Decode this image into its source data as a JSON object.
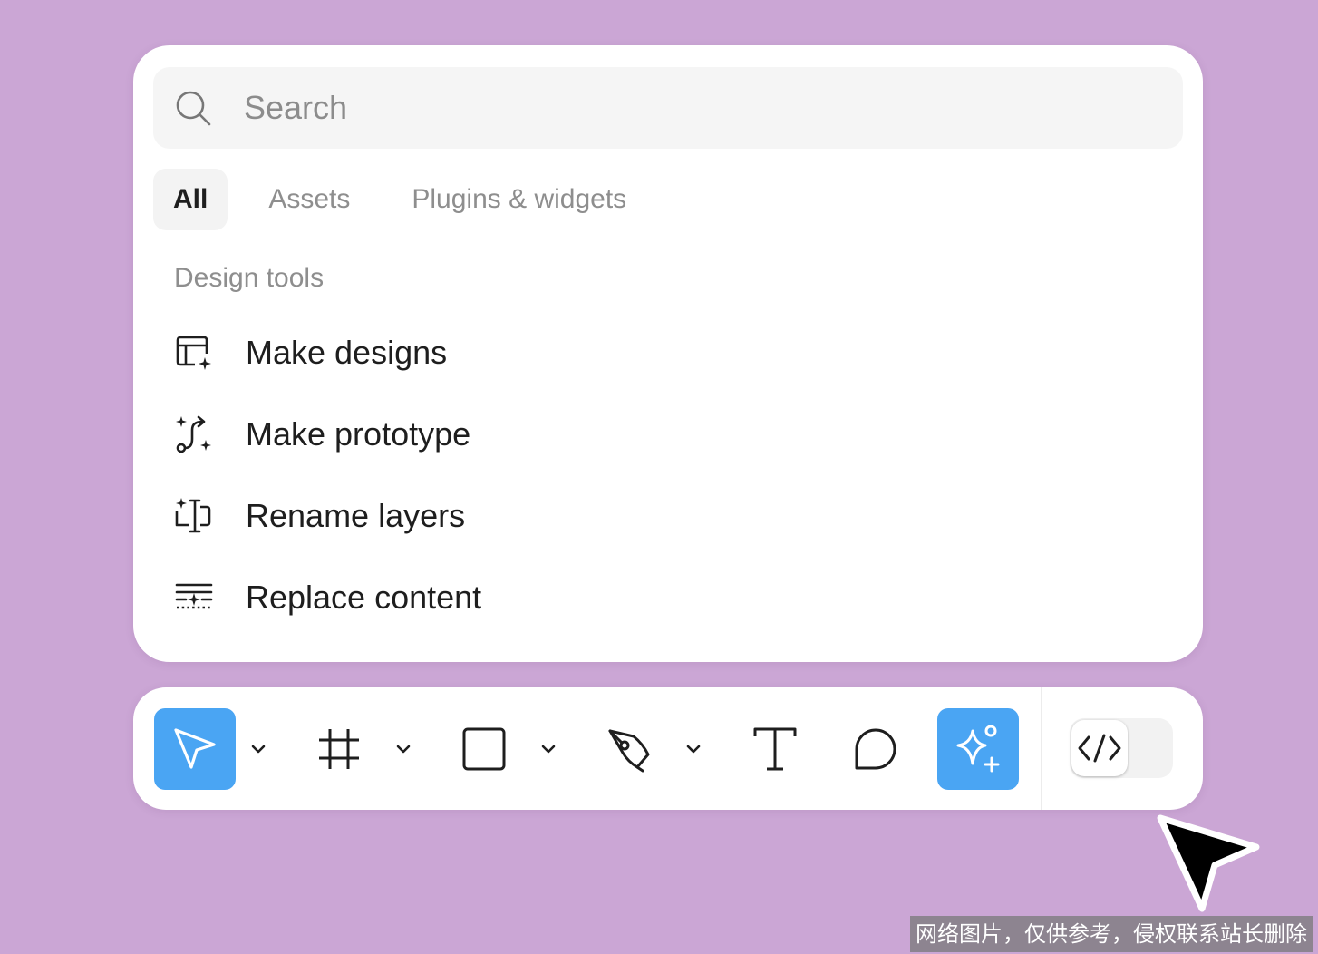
{
  "panel": {
    "search": {
      "placeholder": "Search",
      "value": "",
      "icon": "search-icon"
    },
    "tabs": [
      {
        "label": "All",
        "active": true
      },
      {
        "label": "Assets",
        "active": false
      },
      {
        "label": "Plugins & widgets",
        "active": false
      }
    ],
    "section_heading": "Design tools",
    "items": [
      {
        "label": "Make designs",
        "icon": "make-designs-icon"
      },
      {
        "label": "Make prototype",
        "icon": "make-prototype-icon"
      },
      {
        "label": "Rename layers",
        "icon": "rename-layers-icon"
      },
      {
        "label": "Replace content",
        "icon": "replace-content-icon"
      }
    ]
  },
  "toolbar": {
    "tools": [
      {
        "name": "move",
        "icon": "move-cursor-icon",
        "selected": true,
        "has_menu": true
      },
      {
        "name": "frame",
        "icon": "frame-icon",
        "selected": false,
        "has_menu": true
      },
      {
        "name": "rectangle",
        "icon": "rectangle-icon",
        "selected": false,
        "has_menu": true
      },
      {
        "name": "pen",
        "icon": "pen-icon",
        "selected": false,
        "has_menu": true
      },
      {
        "name": "text",
        "icon": "text-icon",
        "selected": false,
        "has_menu": false
      },
      {
        "name": "comment",
        "icon": "comment-icon",
        "selected": false,
        "has_menu": false
      },
      {
        "name": "actions",
        "icon": "ai-sparkle-icon",
        "selected": true,
        "has_menu": false
      }
    ],
    "dev_mode": {
      "icon": "code-icon",
      "enabled": false
    }
  },
  "colors": {
    "background": "#cba6d5",
    "accent": "#4aa5f3",
    "panel": "#ffffff",
    "search_fill": "#f5f5f5",
    "muted_text": "#8e8e8e",
    "text": "#1e1e1e"
  },
  "watermark": "网络图片，仅供参考，侵权联系站长删除"
}
